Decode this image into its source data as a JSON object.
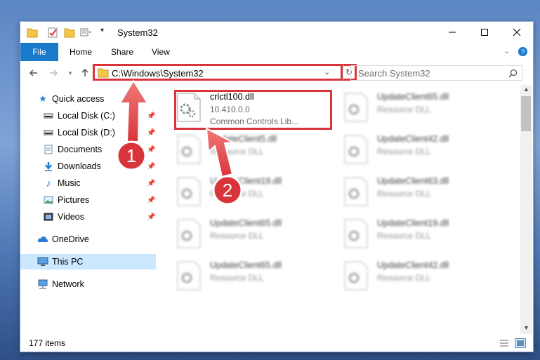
{
  "window": {
    "title": "System32"
  },
  "ribbon": {
    "tabs": [
      "File",
      "Home",
      "Share",
      "View"
    ]
  },
  "address": {
    "path": "C:\\Windows\\System32"
  },
  "search": {
    "placeholder": "Search System32"
  },
  "sidebar": {
    "items": [
      {
        "label": "Quick access",
        "icon": "star-icon"
      },
      {
        "label": "Local Disk (C:)",
        "icon": "drive-icon"
      },
      {
        "label": "Local Disk (D:)",
        "icon": "drive-icon"
      },
      {
        "label": "Documents",
        "icon": "documents-icon"
      },
      {
        "label": "Downloads",
        "icon": "download-icon"
      },
      {
        "label": "Music",
        "icon": "music-icon"
      },
      {
        "label": "Pictures",
        "icon": "pictures-icon"
      },
      {
        "label": "Videos",
        "icon": "videos-icon"
      },
      {
        "label": "OneDrive",
        "icon": "cloud-icon"
      },
      {
        "label": "This PC",
        "icon": "computer-icon"
      },
      {
        "label": "Network",
        "icon": "network-icon"
      }
    ]
  },
  "files": [
    {
      "name": "crlctl100.dll",
      "version": "10.410.0.0",
      "desc": "Common Controls Lib..."
    },
    {
      "name": "UpdateClient65.dll",
      "desc": "Resource DLL"
    },
    {
      "name": "UpdateClient5.dll",
      "desc": "Resource DLL"
    },
    {
      "name": "UpdateClient42.dll",
      "desc": "Resource DLL"
    },
    {
      "name": "UpdateClient19.dll",
      "desc": "Resource DLL"
    },
    {
      "name": "UpdateClient63.dll",
      "desc": "Resource DLL"
    },
    {
      "name": "UpdateClient65.dll",
      "desc": "Resource DLL"
    },
    {
      "name": "UpdateClient19.dll",
      "desc": "Resource DLL"
    },
    {
      "name": "UpdateClient65.dll",
      "desc": "Resource DLL"
    },
    {
      "name": "UpdateClient42.dll",
      "desc": "Resource DLL"
    }
  ],
  "status": {
    "count": "177 items"
  },
  "annotations": {
    "step1": "1",
    "step2": "2"
  },
  "colors": {
    "accent": "#1979ca",
    "highlight": "#d9343b"
  }
}
